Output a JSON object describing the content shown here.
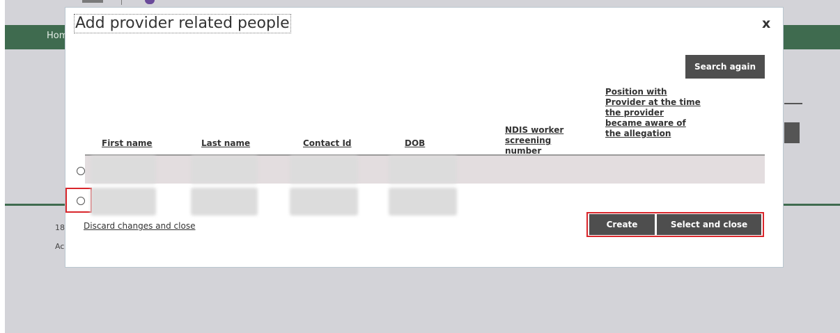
{
  "background": {
    "nav_fragment": "Hom",
    "text_18": "18",
    "text_ac": "Ac"
  },
  "modal": {
    "title": "Add provider related people",
    "close_label": "x",
    "search_again_label": "Search again",
    "columns": [
      "First name",
      "Last name",
      "Contact Id",
      "DOB",
      "NDIS worker screening number",
      "Position with Provider at the time the provider became aware of the allegation"
    ],
    "discard_label": "Discard changes and close",
    "create_label": "Create",
    "select_close_label": "Select and close"
  },
  "colors": {
    "brand_green": "#3f6b4f",
    "button_dark": "#4e4e4e",
    "highlight_red": "#d9262b"
  }
}
